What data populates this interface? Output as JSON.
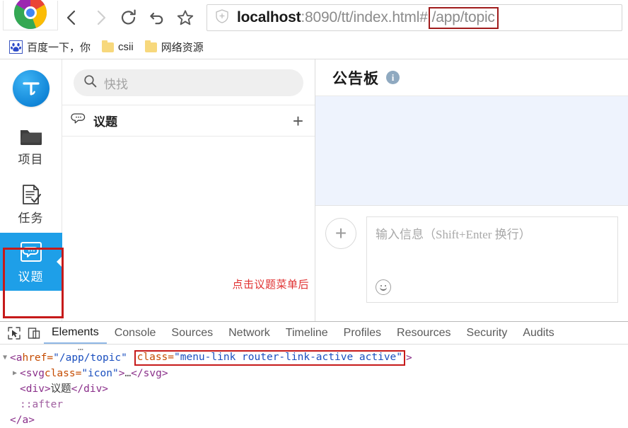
{
  "browser": {
    "nav": {
      "back": "back-arrow",
      "forward": "forward-arrow",
      "reload": "reload-icon",
      "undo": "undo-arrow",
      "bookmark": "star-icon"
    },
    "omnibox": {
      "security_icon": "shield-icon",
      "host": "localhost",
      "rest": ":8090/tt/index.html#",
      "hash_path": "/app/topic",
      "full_url": "localhost:8090/tt/index.html#/app/topic"
    },
    "bookmarks": [
      {
        "label": "百度一下，你",
        "icon": "baidu-icon"
      },
      {
        "label": "csii",
        "icon": "folder-icon"
      },
      {
        "label": "网络资源",
        "icon": "folder-icon"
      }
    ]
  },
  "app": {
    "rail": {
      "logo_letter": "T",
      "items": [
        {
          "label": "项目",
          "icon": "folder-icon",
          "active": false
        },
        {
          "label": "任务",
          "icon": "document-check-icon",
          "active": false
        },
        {
          "label": "议题",
          "icon": "chat-bubble-icon",
          "active": true
        }
      ]
    },
    "list_panel": {
      "search_placeholder": "快找",
      "search_icon": "search-icon",
      "group_icon": "chat-bubble-icon",
      "group_label": "议题",
      "add_label": "+",
      "annotation": "点击议题菜单后"
    },
    "chat_panel": {
      "title": "公告板",
      "info_icon": "info-icon",
      "info_glyph": "i",
      "add_label": "+",
      "editor_placeholder": "输入信息（Shift+Enter 换行）",
      "emoji_icon": "smiley-icon",
      "board_bg": "#eef3fd"
    },
    "colors": {
      "accent": "#1e9fe8",
      "annotation": "#c61a1a",
      "note_text": "#e03030"
    }
  },
  "devtools": {
    "icons": [
      {
        "name": "inspect-element-icon"
      },
      {
        "name": "device-toolbar-icon"
      }
    ],
    "tabs": [
      {
        "label": "Elements",
        "active": true
      },
      {
        "label": "Console",
        "active": false
      },
      {
        "label": "Sources",
        "active": false
      },
      {
        "label": "Network",
        "active": false
      },
      {
        "label": "Timeline",
        "active": false
      },
      {
        "label": "Profiles",
        "active": false
      },
      {
        "label": "Resources",
        "active": false
      },
      {
        "label": "Security",
        "active": false
      },
      {
        "label": "Audits",
        "active": false
      }
    ],
    "dom": {
      "ellipsis": "…",
      "line1": {
        "triangle": "▼",
        "open": "<a ",
        "attr_href": "href=",
        "val_href": "\"/app/topic\"",
        "attr_class": "class=",
        "val_class": "\"menu-link router-link-active active\"",
        "close": ">"
      },
      "line2": {
        "triangle": "▶",
        "open": "<svg ",
        "attr_class": "class=",
        "val_class": "\"icon\"",
        "close": ">",
        "ellipsis": "…",
        "end": "</svg>"
      },
      "line3": {
        "open": "<div>",
        "text": "议题",
        "close": "</div>"
      },
      "line4": {
        "pseudo": "::after"
      },
      "line5": {
        "close": "</a>"
      }
    }
  }
}
